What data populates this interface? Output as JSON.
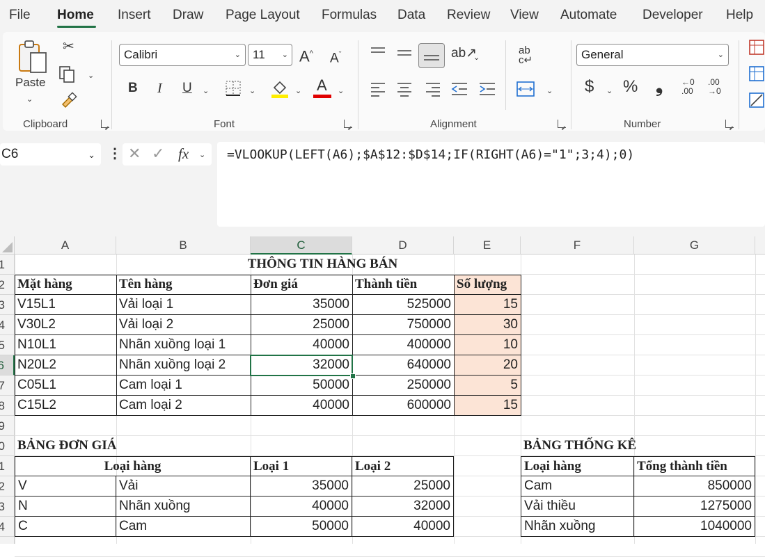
{
  "ribbon": {
    "tabs": [
      "File",
      "Home",
      "Insert",
      "Draw",
      "Page Layout",
      "Formulas",
      "Data",
      "Review",
      "View",
      "Automate",
      "Developer",
      "Help"
    ],
    "active_tab": "Home",
    "clipboard": {
      "paste_label": "Paste",
      "group_label": "Clipboard"
    },
    "font": {
      "name": "Calibri",
      "size": "11",
      "bold": "B",
      "italic": "I",
      "underline": "U",
      "group_label": "Font"
    },
    "alignment": {
      "group_label": "Alignment"
    },
    "number": {
      "format": "General",
      "currency": "$",
      "percent": "%",
      "comma": "❟",
      "group_label": "Number"
    }
  },
  "formula_bar": {
    "name_box": "C6",
    "fx": "fx",
    "formula": "=VLOOKUP(LEFT(A6);$A$12:$D$14;IF(RIGHT(A6)=\"1\";3;4);0)"
  },
  "sheet": {
    "columns": [
      "A",
      "B",
      "C",
      "D",
      "E",
      "F",
      "G"
    ],
    "selected_column": "C",
    "rows": [
      "1",
      "2",
      "3",
      "4",
      "5",
      "6",
      "7",
      "8",
      "9",
      "10",
      "11",
      "12",
      "13",
      "14"
    ],
    "selected_row": "6",
    "title": "THÔNG TIN HÀNG BÁN",
    "headers": [
      "Mặt hàng",
      "Tên hàng",
      "Đơn giá",
      "Thành tiền",
      "Số lượng"
    ],
    "data": [
      [
        "V15L1",
        "Vải loại 1",
        "35000",
        "525000",
        "15"
      ],
      [
        "V30L2",
        "Vải loại 2",
        "25000",
        "750000",
        "30"
      ],
      [
        "N10L1",
        "Nhãn xuồng loại 1",
        "40000",
        "400000",
        "10"
      ],
      [
        "N20L2",
        "Nhãn xuồng loại 2",
        "32000",
        "640000",
        "20"
      ],
      [
        "C05L1",
        "Cam loại 1",
        "50000",
        "250000",
        "5"
      ],
      [
        "C15L2",
        "Cam loại 2",
        "40000",
        "600000",
        "15"
      ]
    ],
    "price_table": {
      "title": "BẢNG ĐƠN GIÁ",
      "headers": [
        "Loại hàng",
        "Loại 1",
        "Loại 2"
      ],
      "rows": [
        [
          "V",
          "Vải",
          "35000",
          "25000"
        ],
        [
          "N",
          "Nhãn xuồng",
          "40000",
          "32000"
        ],
        [
          "C",
          "Cam",
          "50000",
          "40000"
        ]
      ]
    },
    "stats_table": {
      "title": "BẢNG THỐNG KÊ",
      "headers": [
        "Loại hàng",
        "Tổng thành tiền"
      ],
      "rows": [
        [
          "Cam",
          "850000"
        ],
        [
          "Vải thiều",
          "1275000"
        ],
        [
          "Nhãn xuồng",
          "1040000"
        ]
      ]
    }
  },
  "colors": {
    "accent": "#217346",
    "highlight": "#fce4d6"
  }
}
